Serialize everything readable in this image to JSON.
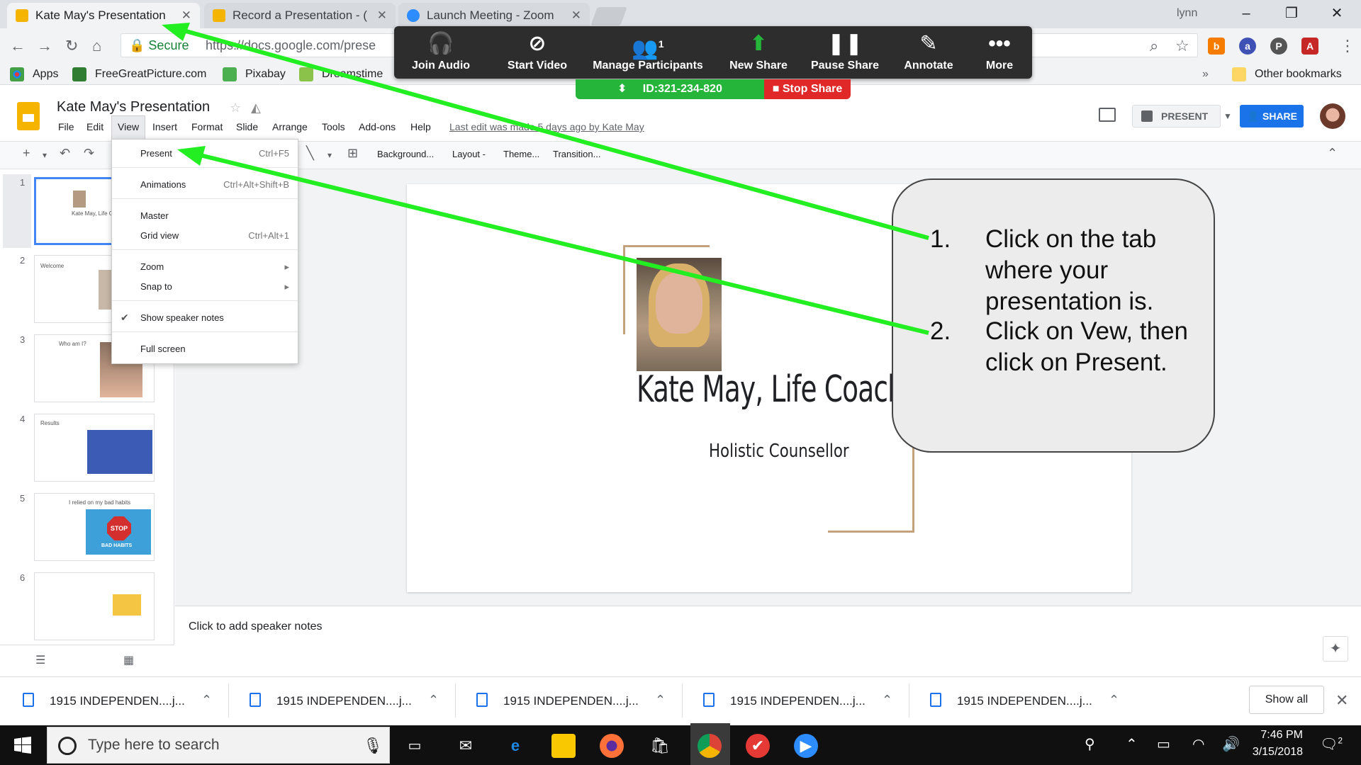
{
  "browser": {
    "tabs": [
      {
        "title": "Kate May's Presentation",
        "color": "#f4b400"
      },
      {
        "title": "Record a Presentation - (",
        "color": "#f4b400"
      },
      {
        "title": "Launch Meeting - Zoom",
        "color": "#2d8cff"
      }
    ],
    "user": "lynn",
    "secure_label": "Secure",
    "url": "https://docs.google.com/prese",
    "bookmarks": [
      "Apps",
      "FreeGreatPicture.com",
      "Pixabay",
      "Dreamstime",
      "Other bookmarks"
    ]
  },
  "zoom": {
    "buttons": [
      {
        "label": "Join Audio",
        "icon": "headphones-icon"
      },
      {
        "label": "Start Video",
        "icon": "video-off-icon"
      },
      {
        "label": "Manage Participants",
        "icon": "participants-icon",
        "count": "1"
      },
      {
        "label": "New Share",
        "icon": "share-up-icon"
      },
      {
        "label": "Pause Share",
        "icon": "pause-icon"
      },
      {
        "label": "Annotate",
        "icon": "pencil-icon"
      },
      {
        "label": "More",
        "icon": "more-icon"
      }
    ],
    "meeting_id": "ID:321-234-820",
    "stop_share": "Stop Share",
    "accent_green": "#25b53a",
    "stop_red": "#e02828"
  },
  "slides": {
    "doc_title": "Kate May's Presentation",
    "menus": [
      "File",
      "Edit",
      "View",
      "Insert",
      "Format",
      "Slide",
      "Arrange",
      "Tools",
      "Add-ons",
      "Help"
    ],
    "last_edit": "Last edit was made 5 days ago by Kate May",
    "present_label": "PRESENT",
    "share_label": "SHARE",
    "toolbar": [
      "Background...",
      "Layout -",
      "Theme...",
      "Transition..."
    ],
    "view_menu": [
      {
        "label": "Present",
        "shortcut": "Ctrl+F5"
      },
      {
        "label": "Animations",
        "shortcut": "Ctrl+Alt+Shift+B"
      },
      {
        "label": "Master",
        "shortcut": ""
      },
      {
        "label": "Grid view",
        "shortcut": "Ctrl+Alt+1"
      },
      {
        "label": "Zoom",
        "shortcut": "▸"
      },
      {
        "label": "Snap to",
        "shortcut": "▸"
      },
      {
        "label": "Show speaker notes",
        "shortcut": "",
        "checked": true
      },
      {
        "label": "Full screen",
        "shortcut": ""
      }
    ],
    "thumbnails": [
      {
        "num": "1",
        "text": "Kate May, Life Co"
      },
      {
        "num": "2",
        "text": "Welcome"
      },
      {
        "num": "3",
        "text": "Who am I?"
      },
      {
        "num": "4",
        "text": "Results"
      },
      {
        "num": "5",
        "text": "I relied on my bad habits",
        "sign": "STOP",
        "sign2": "BAD HABITS"
      },
      {
        "num": "6",
        "text": ""
      }
    ],
    "slide_title": "Kate May, Life Coach",
    "slide_subtitle": "Holistic Counsellor",
    "speaker_notes": "Click to add speaker notes"
  },
  "callout": {
    "steps": [
      {
        "num": "1.",
        "text": "Click on the tab where your presentation is."
      },
      {
        "num": "2.",
        "text": "Click on Vew, then click on Present."
      }
    ],
    "arrow_color": "#22ee22"
  },
  "downloads": {
    "items": [
      "1915 INDEPENDEN....j...",
      "1915 INDEPENDEN....j...",
      "1915 INDEPENDEN....j...",
      "1915 INDEPENDEN....j...",
      "1915 INDEPENDEN....j..."
    ],
    "show_all": "Show all"
  },
  "taskbar": {
    "search_placeholder": "Type here to search",
    "time": "7:46 PM",
    "date": "3/15/2018",
    "notification_count": "2"
  }
}
